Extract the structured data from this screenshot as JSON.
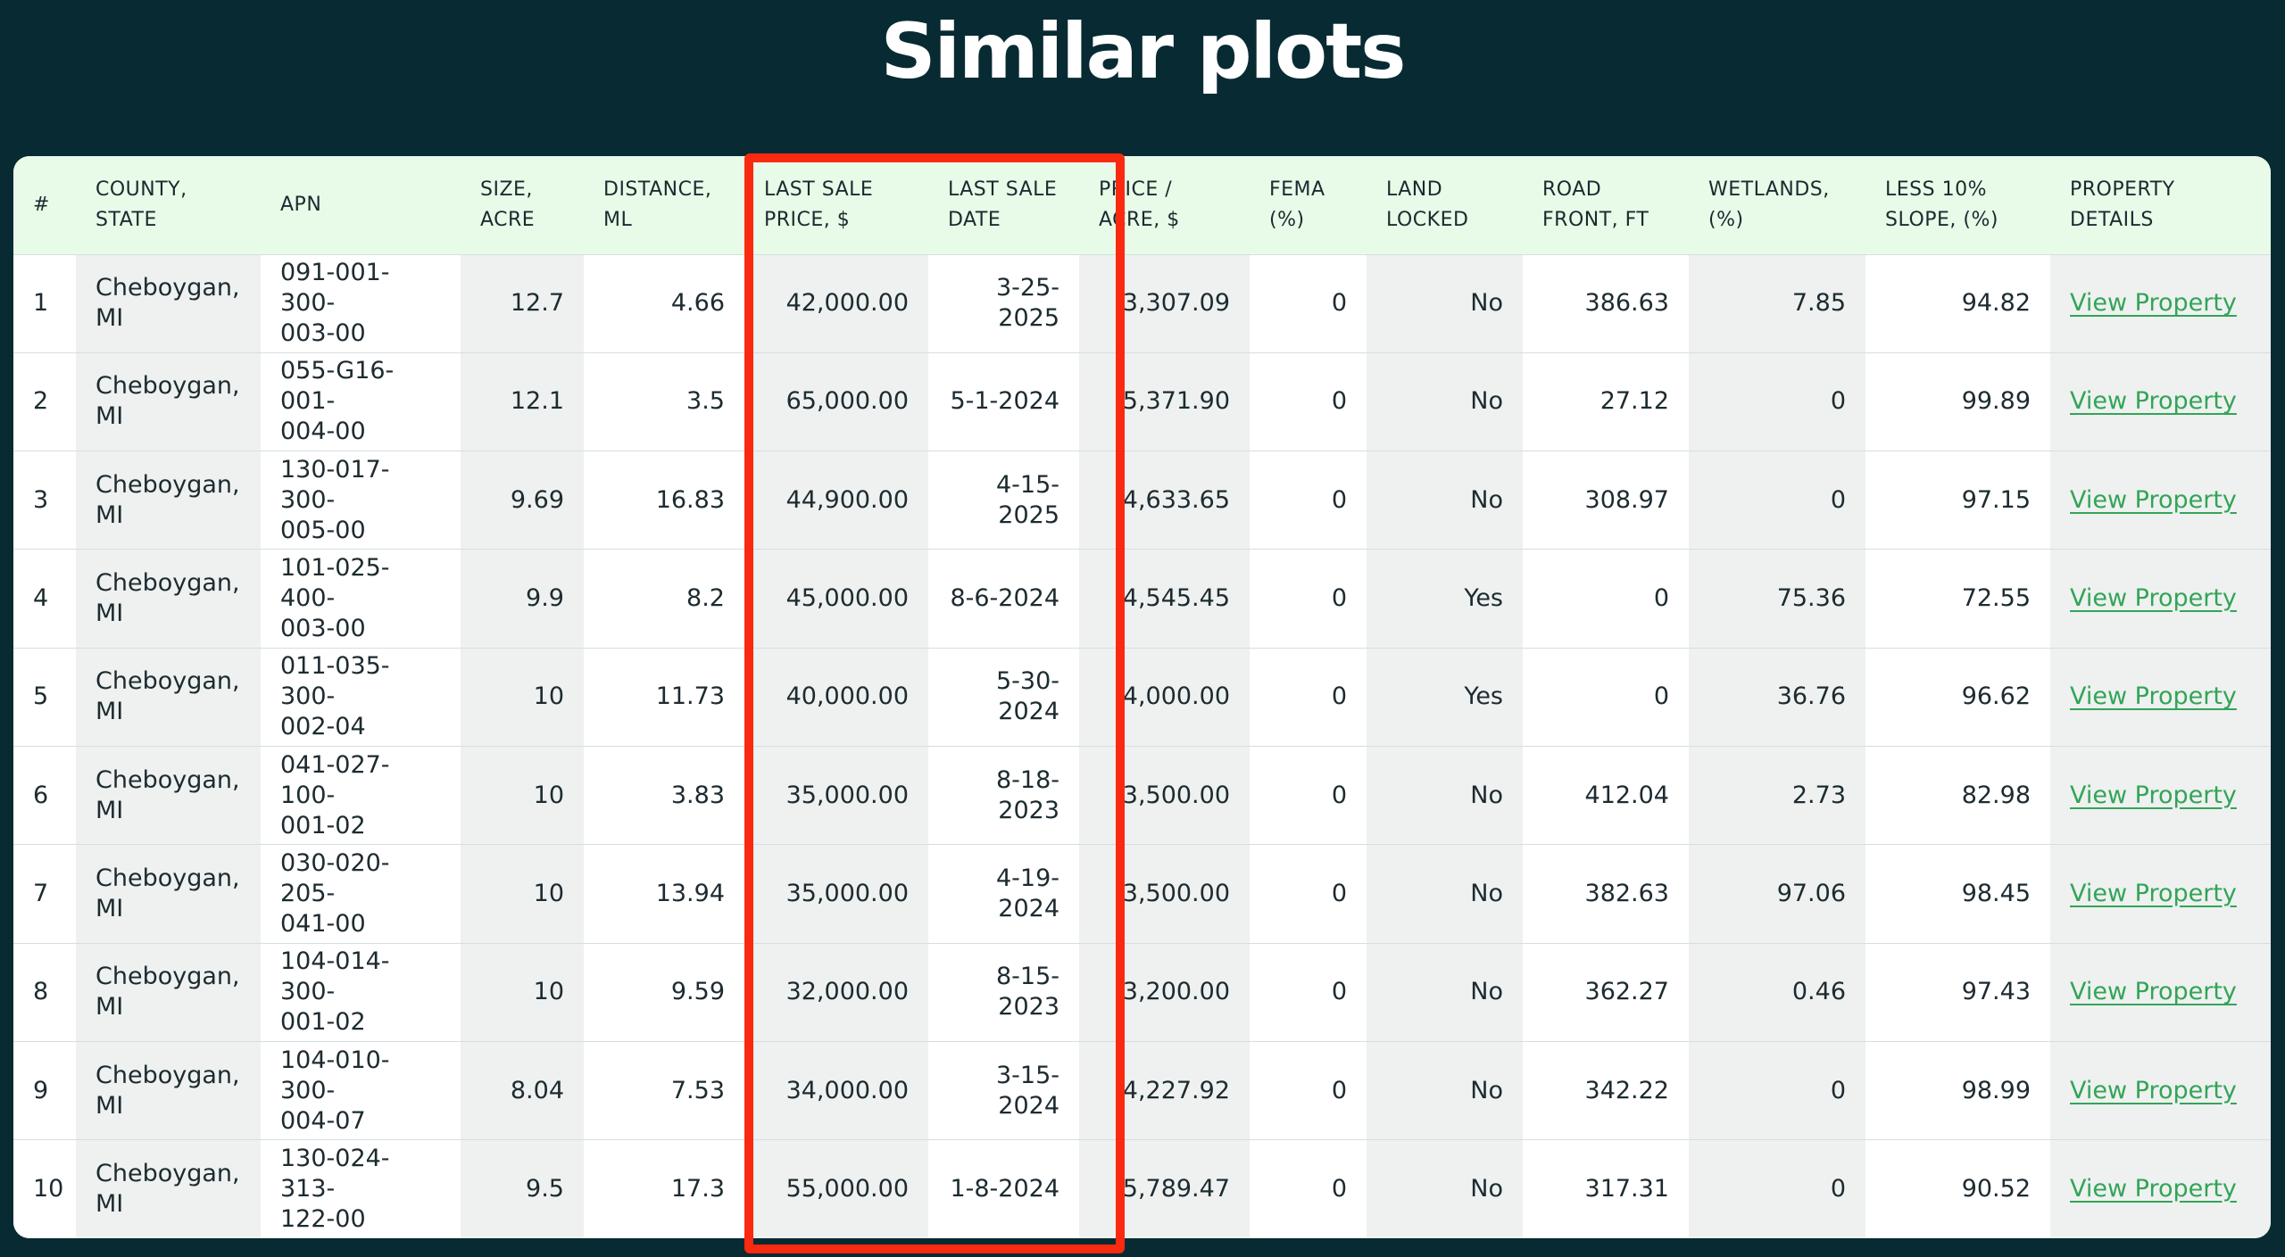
{
  "page": {
    "title": "Similar plots"
  },
  "table": {
    "columns": [
      "#",
      "COUNTY,\nSTATE",
      "APN",
      "SIZE,\nACRE",
      "DISTANCE,\nML",
      "LAST SALE\nPRICE, $",
      "LAST SALE\nDATE",
      "PRICE /\nACRE, $",
      "FEMA\n(%)",
      "LAND\nLOCKED",
      "ROAD\nFRONT, FT",
      "WETLANDS,\n(%)",
      "LESS 10%\nSLOPE, (%)",
      "PROPERTY\nDETAILS"
    ],
    "rows": [
      {
        "index": "1",
        "county": "Cheboygan,\nMI",
        "apn": "091-001-300-\n003-00",
        "size": "12.7",
        "distance": "4.66",
        "last_sale_price": "42,000.00",
        "last_sale_date": "3-25-2025",
        "price_per_acre": "3,307.09",
        "fema": "0",
        "land_locked": "No",
        "road_front": "386.63",
        "wetlands": "7.85",
        "slope": "94.82",
        "details": "View Property"
      },
      {
        "index": "2",
        "county": "Cheboygan,\nMI",
        "apn": "055-G16-001-\n004-00",
        "size": "12.1",
        "distance": "3.5",
        "last_sale_price": "65,000.00",
        "last_sale_date": "5-1-2024",
        "price_per_acre": "5,371.90",
        "fema": "0",
        "land_locked": "No",
        "road_front": "27.12",
        "wetlands": "0",
        "slope": "99.89",
        "details": "View Property"
      },
      {
        "index": "3",
        "county": "Cheboygan,\nMI",
        "apn": "130-017-300-\n005-00",
        "size": "9.69",
        "distance": "16.83",
        "last_sale_price": "44,900.00",
        "last_sale_date": "4-15-2025",
        "price_per_acre": "4,633.65",
        "fema": "0",
        "land_locked": "No",
        "road_front": "308.97",
        "wetlands": "0",
        "slope": "97.15",
        "details": "View Property"
      },
      {
        "index": "4",
        "county": "Cheboygan,\nMI",
        "apn": "101-025-400-\n003-00",
        "size": "9.9",
        "distance": "8.2",
        "last_sale_price": "45,000.00",
        "last_sale_date": "8-6-2024",
        "price_per_acre": "4,545.45",
        "fema": "0",
        "land_locked": "Yes",
        "road_front": "0",
        "wetlands": "75.36",
        "slope": "72.55",
        "details": "View Property"
      },
      {
        "index": "5",
        "county": "Cheboygan,\nMI",
        "apn": "011-035-300-\n002-04",
        "size": "10",
        "distance": "11.73",
        "last_sale_price": "40,000.00",
        "last_sale_date": "5-30-2024",
        "price_per_acre": "4,000.00",
        "fema": "0",
        "land_locked": "Yes",
        "road_front": "0",
        "wetlands": "36.76",
        "slope": "96.62",
        "details": "View Property"
      },
      {
        "index": "6",
        "county": "Cheboygan,\nMI",
        "apn": "041-027-100-\n001-02",
        "size": "10",
        "distance": "3.83",
        "last_sale_price": "35,000.00",
        "last_sale_date": "8-18-2023",
        "price_per_acre": "3,500.00",
        "fema": "0",
        "land_locked": "No",
        "road_front": "412.04",
        "wetlands": "2.73",
        "slope": "82.98",
        "details": "View Property"
      },
      {
        "index": "7",
        "county": "Cheboygan,\nMI",
        "apn": "030-020-205-\n041-00",
        "size": "10",
        "distance": "13.94",
        "last_sale_price": "35,000.00",
        "last_sale_date": "4-19-2024",
        "price_per_acre": "3,500.00",
        "fema": "0",
        "land_locked": "No",
        "road_front": "382.63",
        "wetlands": "97.06",
        "slope": "98.45",
        "details": "View Property"
      },
      {
        "index": "8",
        "county": "Cheboygan,\nMI",
        "apn": "104-014-300-\n001-02",
        "size": "10",
        "distance": "9.59",
        "last_sale_price": "32,000.00",
        "last_sale_date": "8-15-2023",
        "price_per_acre": "3,200.00",
        "fema": "0",
        "land_locked": "No",
        "road_front": "362.27",
        "wetlands": "0.46",
        "slope": "97.43",
        "details": "View Property"
      },
      {
        "index": "9",
        "county": "Cheboygan,\nMI",
        "apn": "104-010-300-\n004-07",
        "size": "8.04",
        "distance": "7.53",
        "last_sale_price": "34,000.00",
        "last_sale_date": "3-15-2024",
        "price_per_acre": "4,227.92",
        "fema": "0",
        "land_locked": "No",
        "road_front": "342.22",
        "wetlands": "0",
        "slope": "98.99",
        "details": "View Property"
      },
      {
        "index": "10",
        "county": "Cheboygan,\nMI",
        "apn": "130-024-313-\n122-00",
        "size": "9.5",
        "distance": "17.3",
        "last_sale_price": "55,000.00",
        "last_sale_date": "1-8-2024",
        "price_per_acre": "5,789.47",
        "fema": "0",
        "land_locked": "No",
        "road_front": "317.31",
        "wetlands": "0",
        "slope": "90.52",
        "details": "View Property"
      }
    ]
  },
  "colors": {
    "background": "#082a33",
    "header_row": "#e8fbe8",
    "shaded_column": "#eef1f0",
    "link": "#33a457",
    "highlight_border": "#fa2a10"
  }
}
